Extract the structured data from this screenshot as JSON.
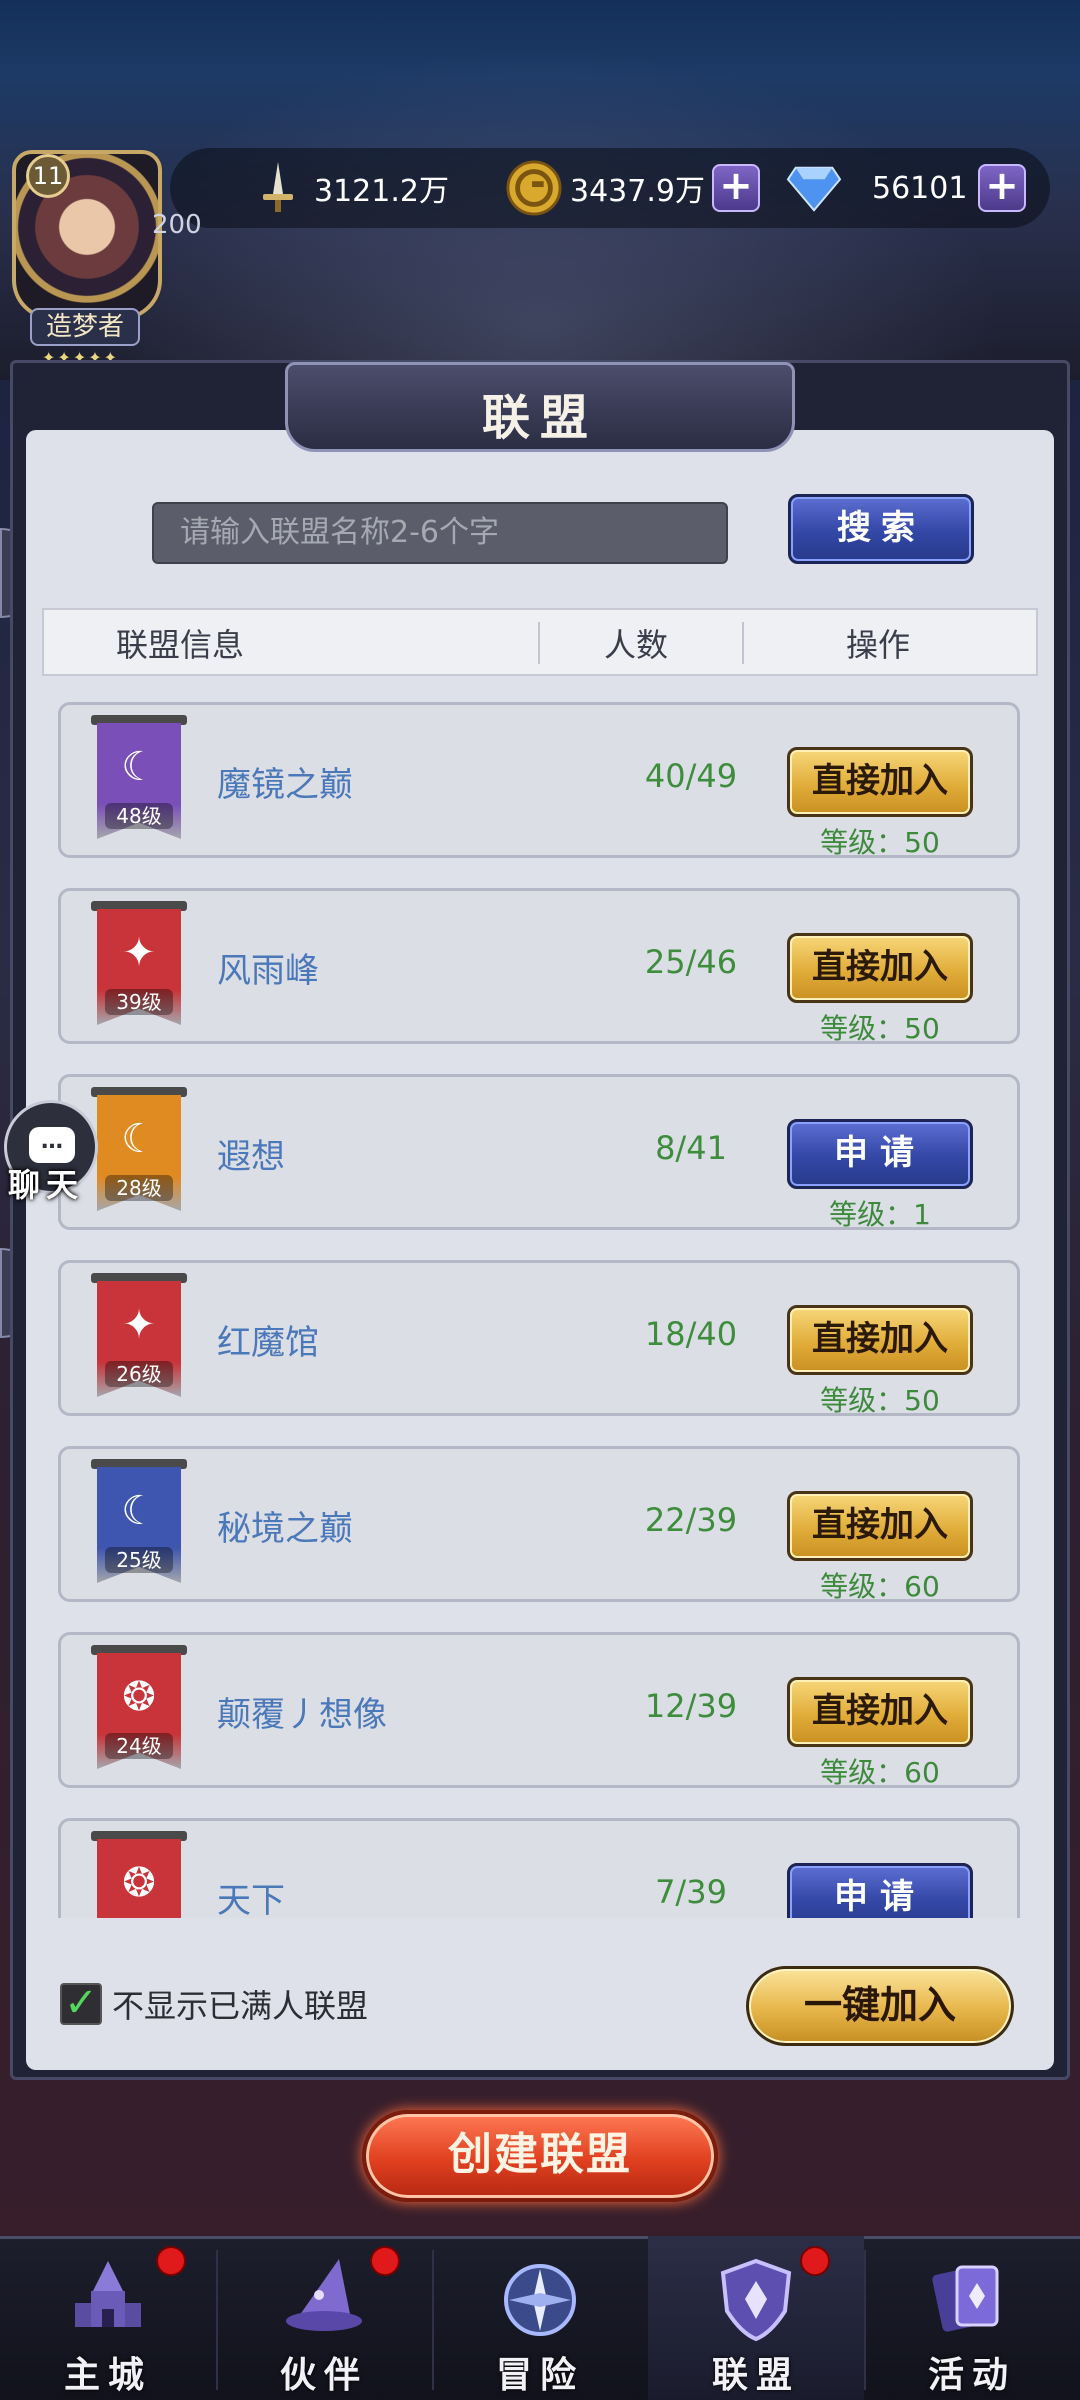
{
  "hud": {
    "player_level": "11",
    "player_title": "造梦者",
    "player_stars": "✦✦✦✦✦",
    "player_number": "200",
    "power_value": "3121.2万",
    "gold_value": "3437.9万",
    "diamond_value": "56101",
    "plus_label": "+"
  },
  "panel": {
    "title": "联盟",
    "search_placeholder": "请输入联盟名称2-6个字",
    "search_button": "搜索",
    "columns": [
      "联盟信息",
      "人数",
      "操作"
    ],
    "requirement_prefix": "等级："
  },
  "alliances": [
    {
      "name": "魔镜之巅",
      "level_tag": "48级",
      "members": "40/49",
      "action": "直接加入",
      "action_type": "join",
      "requirement": "等级：50",
      "flag_color": "#7a4fb8",
      "emblem": "☾"
    },
    {
      "name": "风雨峰",
      "level_tag": "39级",
      "members": "25/46",
      "action": "直接加入",
      "action_type": "join",
      "requirement": "等级：50",
      "flag_color": "#c8343a",
      "emblem": "✦"
    },
    {
      "name": "遐想",
      "level_tag": "28级",
      "members": "8/41",
      "action": "申请",
      "action_type": "apply",
      "requirement": "等级：1",
      "flag_color": "#e08a22",
      "emblem": "☾"
    },
    {
      "name": "红魔馆",
      "level_tag": "26级",
      "members": "18/40",
      "action": "直接加入",
      "action_type": "join",
      "requirement": "等级：50",
      "flag_color": "#c8343a",
      "emblem": "✦"
    },
    {
      "name": "秘境之巅",
      "level_tag": "25级",
      "members": "22/39",
      "action": "直接加入",
      "action_type": "join",
      "requirement": "等级：60",
      "flag_color": "#3f56b0",
      "emblem": "☾"
    },
    {
      "name": "颠覆丿想像",
      "level_tag": "24级",
      "members": "12/39",
      "action": "直接加入",
      "action_type": "join",
      "requirement": "等级：60",
      "flag_color": "#c8343a",
      "emblem": "❂"
    },
    {
      "name": "天下",
      "level_tag": "",
      "members": "7/39",
      "action": "申请",
      "action_type": "apply",
      "requirement": "",
      "flag_color": "#c8343a",
      "emblem": "❂"
    }
  ],
  "footer": {
    "hide_full_label": "不显示已满人联盟",
    "hide_full_checked": true,
    "one_key_join": "一键加入",
    "create_alliance": "创建联盟"
  },
  "chat": {
    "label": "聊天"
  },
  "nav": {
    "items": [
      {
        "label": "主城",
        "icon": "castle-icon",
        "badge": true
      },
      {
        "label": "伙伴",
        "icon": "wizard-hat-icon",
        "badge": true
      },
      {
        "label": "冒险",
        "icon": "compass-icon",
        "badge": false
      },
      {
        "label": "联盟",
        "icon": "shield-icon",
        "badge": true,
        "active": true
      },
      {
        "label": "活动",
        "icon": "cards-icon",
        "badge": false
      }
    ]
  },
  "colors": {
    "join_button": "#e1ad3a",
    "apply_button": "#3347a6",
    "member_text": "#3e8d3d",
    "name_text": "#4a78b8"
  }
}
